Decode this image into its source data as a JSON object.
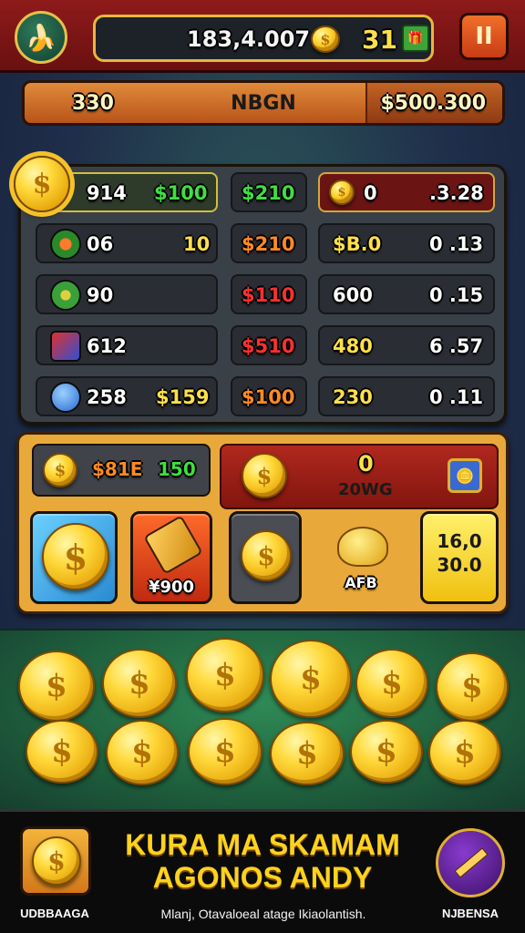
{
  "top_bar": {
    "menu_icon": "banana-icon",
    "score": "183,4.007",
    "gems": "31",
    "pause_label": "II"
  },
  "title_strip": {
    "left": "330",
    "center": "NBGN",
    "right": "$500.300"
  },
  "stats": [
    {
      "icon": "sun-coin-icon",
      "col1": "914",
      "col2": "$100",
      "col3": "$210",
      "col4": "0",
      "col5": ".3.28"
    },
    {
      "icon": "green-gem-icon",
      "col1": "06",
      "col2": "10",
      "col3": "$210",
      "col4": "$B.0",
      "col5": "0 .13"
    },
    {
      "icon": "green-ring-icon",
      "col1": "90",
      "col2": "",
      "col3": "$110",
      "col4": "600",
      "col5": "0 .15"
    },
    {
      "icon": "dice-icon",
      "col1": "612",
      "col2": "",
      "col3": "$510",
      "col4": "480",
      "col5": "6 .57"
    },
    {
      "icon": "globe-icon",
      "col1": "258",
      "col2": "$159",
      "col3": "$100",
      "col4": "230",
      "col5": "0 .11"
    }
  ],
  "shop": {
    "top_left_label": "$81E",
    "top_left_value": "150",
    "top_right_value": "0",
    "top_right_label": "20WG",
    "tiles": {
      "axe_price": "¥900",
      "bowl_label": "AFB",
      "gold_box_line1": "16,0",
      "gold_box_line2": "30.0"
    }
  },
  "banner": {
    "headline_line1": "KURA MA SKAMAM",
    "headline_line2": "AGONOS ANDY",
    "tagline": "Mlanj, Otavaloeal atage Ikiaolantish.",
    "left_label": "UDBBAAGA",
    "right_label": "NJBENSA"
  }
}
